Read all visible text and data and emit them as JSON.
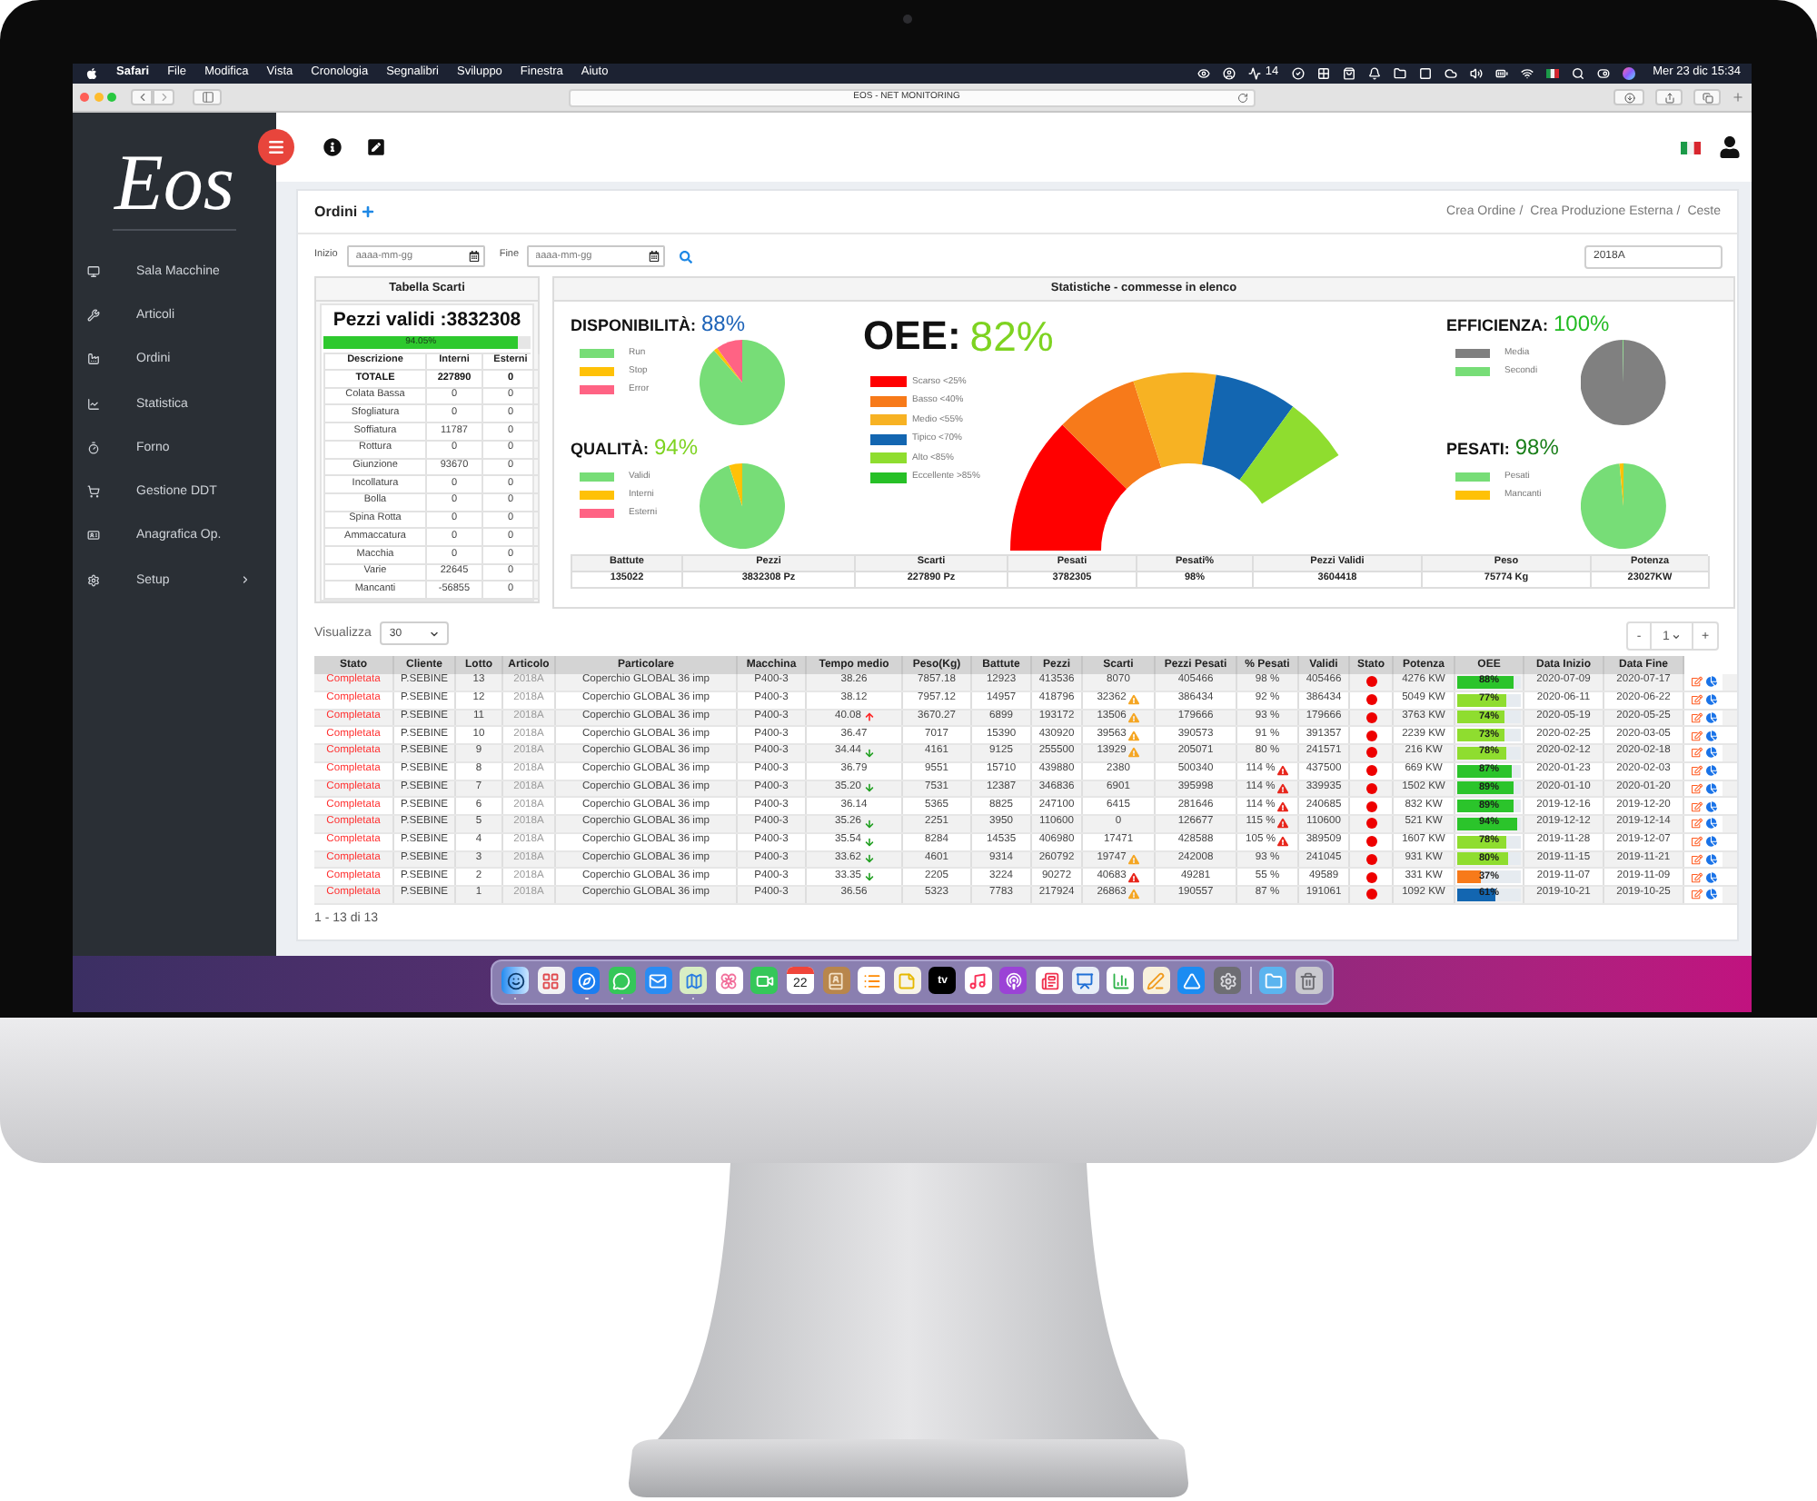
{
  "menu_bar": {
    "app": "Safari",
    "menus": [
      "File",
      "Modifica",
      "Vista",
      "Cronologia",
      "Segnalibri",
      "Sviluppo",
      "Finestra",
      "Aiuto"
    ],
    "badge": "14",
    "clock": "Mer 23 dic 15:34"
  },
  "browser": {
    "address": "EOS - NET MONITORING"
  },
  "sidebar": {
    "logo": "Eos",
    "items": [
      {
        "label": "Sala Macchine",
        "submenu": false
      },
      {
        "label": "Articoli",
        "submenu": false
      },
      {
        "label": "Ordini",
        "submenu": false
      },
      {
        "label": "Statistica",
        "submenu": false
      },
      {
        "label": "Forno",
        "submenu": false
      },
      {
        "label": "Gestione DDT",
        "submenu": false
      },
      {
        "label": "Anagrafica Op.",
        "submenu": false
      },
      {
        "label": "Setup",
        "submenu": true
      }
    ]
  },
  "page": {
    "title": "Ordini",
    "breadcrumbs": [
      {
        "label": "Crea Ordine",
        "separator": "/"
      },
      {
        "label": "Crea Produzione Esterna",
        "separator": "/"
      },
      {
        "label": "Ceste"
      }
    ]
  },
  "filters": {
    "start": {
      "label": "Inizio",
      "placeholder": "aaaa-mm-gg"
    },
    "end": {
      "label": "Fine",
      "placeholder": "aaaa-mm-gg"
    },
    "article": {
      "value": "2018A"
    }
  },
  "scrap_table": {
    "title": "Tabella Scarti",
    "valid_pieces": "Pezzi validi :3832308",
    "progress": {
      "label": "94.05%",
      "level": 0.9405
    },
    "columns": [
      "Descrizione",
      "Interni",
      "Esterni"
    ],
    "rows": [
      {
        "kind": "total",
        "cells": [
          "TOTALE",
          "227890",
          "0"
        ]
      },
      {
        "kind": "item",
        "cells": [
          "Colata Bassa",
          "0",
          "0"
        ]
      },
      {
        "kind": "item",
        "cells": [
          "Sfogliatura",
          "0",
          "0"
        ]
      },
      {
        "kind": "item",
        "cells": [
          "Soffiatura",
          "11787",
          "0"
        ]
      },
      {
        "kind": "item",
        "cells": [
          "Rottura",
          "0",
          "0"
        ]
      },
      {
        "kind": "item",
        "cells": [
          "Giunzione",
          "93670",
          "0"
        ]
      },
      {
        "kind": "item",
        "cells": [
          "Incollatura",
          "0",
          "0"
        ]
      },
      {
        "kind": "item",
        "cells": [
          "Bolla",
          "0",
          "0"
        ]
      },
      {
        "kind": "item",
        "cells": [
          "Spina Rotta",
          "0",
          "0"
        ]
      },
      {
        "kind": "item",
        "cells": [
          "Ammaccatura",
          "0",
          "0"
        ]
      },
      {
        "kind": "item",
        "cells": [
          "Macchia",
          "0",
          "0"
        ]
      },
      {
        "kind": "item",
        "cells": [
          "Varie",
          "22645",
          "0"
        ]
      },
      {
        "kind": "item",
        "cells": [
          "Mancanti",
          "-56855",
          "0"
        ]
      }
    ]
  },
  "statistics": {
    "title": "Statistiche - commesse in elenco",
    "left_kpis": [
      {
        "label": "DISPONIBILITÀ:",
        "value": "88%",
        "color": "#1d63b8",
        "legend": [
          {
            "label": "Run",
            "color": "#77dd77"
          },
          {
            "label": "Stop",
            "color": "#ffc107"
          },
          {
            "label": "Error",
            "color": "#ff6384"
          }
        ]
      },
      {
        "label": "QUALITÀ:",
        "value": "94%",
        "color": "#7ed321",
        "legend": [
          {
            "label": "Validi",
            "color": "#77dd77"
          },
          {
            "label": "Interni",
            "color": "#ffc107"
          },
          {
            "label": "Esterni",
            "color": "#ff6384"
          }
        ]
      }
    ],
    "oee": {
      "label": "OEE:",
      "value": "82%",
      "color": "#7ed321",
      "legend": [
        {
          "label": "Scarso <25%",
          "color": "#ff0000"
        },
        {
          "label": "Basso <40%",
          "color": "#f77a1a"
        },
        {
          "label": "Medio <55%",
          "color": "#f7b223"
        },
        {
          "label": "Tipico <70%",
          "color": "#1366b1"
        },
        {
          "label": "Alto <85%",
          "color": "#8fdd2f"
        },
        {
          "label": "Eccellente >85%",
          "color": "#27c027"
        }
      ]
    },
    "right_kpis": [
      {
        "label": "EFFICIENZA:",
        "value": "100%",
        "color": "#22bb22",
        "legend": [
          {
            "label": "Media",
            "color": "#808080"
          },
          {
            "label": "Secondi",
            "color": "#77dd77"
          }
        ]
      },
      {
        "label": "PESATI:",
        "value": "98%",
        "color": "#1a7f1a",
        "legend": [
          {
            "label": "Pesati",
            "color": "#77dd77"
          },
          {
            "label": "Mancanti",
            "color": "#ffc107"
          }
        ]
      }
    ],
    "summary": {
      "columns": [
        "Battute",
        "Pezzi",
        "Scarti",
        "Pesati",
        "Pesati%",
        "Pezzi Validi",
        "Peso",
        "Potenza"
      ],
      "values": [
        "135022",
        "3832308 Pz",
        "227890 Pz",
        "3782305",
        "98%",
        "3604418",
        "75774 Kg",
        "23027KW"
      ]
    }
  },
  "orders": {
    "page_size": {
      "label": "Visualizza",
      "value": "30"
    },
    "pager": {
      "previous": "-",
      "page": "1",
      "next": "+"
    },
    "columns": [
      "Stato",
      "Cliente",
      "Lotto",
      "Articolo",
      "Particolare",
      "Macchina",
      "Tempo medio",
      "Peso(Kg)",
      "Battute",
      "Pezzi",
      "Scarti",
      "Pezzi Pesati",
      "% Pesati",
      "Validi",
      "Stato",
      "Potenza",
      "OEE",
      "Data Inizio",
      "Data Fine"
    ],
    "rows": [
      {
        "status": "Completata",
        "client": "P.SEBINE",
        "lot": "13",
        "article": "2018A",
        "part": "Coperchio GLOBAL 36 imp",
        "machine": "P400-3",
        "avg_time": "38.26",
        "trend_up": false,
        "trend_down": false,
        "weight": "7857.18",
        "strokes": "12923",
        "pieces": "413536",
        "scrap": "8070",
        "scrap_warning": {
          "on": false
        },
        "weighed": "405466",
        "weighed_pct": "98 %",
        "weighed_warning": {
          "on": false
        },
        "valid": "405466",
        "color": "#ee0000",
        "power": "4276 KW",
        "oee": {
          "label": "88%",
          "level": 0.88,
          "color": "#2bc42b"
        },
        "start": "2020-07-09",
        "end": "2020-07-17"
      },
      {
        "status": "Completata",
        "client": "P.SEBINE",
        "lot": "12",
        "article": "2018A",
        "part": "Coperchio GLOBAL 36 imp",
        "machine": "P400-3",
        "avg_time": "38.12",
        "trend_up": false,
        "trend_down": false,
        "weight": "7957.12",
        "strokes": "14957",
        "pieces": "418796",
        "scrap": "32362",
        "scrap_warning": {
          "on": true,
          "color": "#f5a623"
        },
        "weighed": "386434",
        "weighed_pct": "92 %",
        "weighed_warning": {
          "on": false
        },
        "valid": "386434",
        "color": "#ee0000",
        "power": "5049 KW",
        "oee": {
          "label": "77%",
          "level": 0.77,
          "color": "#8fdd2f"
        },
        "start": "2020-06-11",
        "end": "2020-06-22"
      },
      {
        "status": "Completata",
        "client": "P.SEBINE",
        "lot": "11",
        "article": "2018A",
        "part": "Coperchio GLOBAL 36 imp",
        "machine": "P400-3",
        "avg_time": "40.08",
        "trend_up": true,
        "trend_down": false,
        "weight": "3670.27",
        "strokes": "6899",
        "pieces": "193172",
        "scrap": "13506",
        "scrap_warning": {
          "on": true,
          "color": "#f5a623"
        },
        "weighed": "179666",
        "weighed_pct": "93 %",
        "weighed_warning": {
          "on": false
        },
        "valid": "179666",
        "color": "#ee0000",
        "power": "3763 KW",
        "oee": {
          "label": "74%",
          "level": 0.74,
          "color": "#8fdd2f"
        },
        "start": "2020-05-19",
        "end": "2020-05-25"
      },
      {
        "status": "Completata",
        "client": "P.SEBINE",
        "lot": "10",
        "article": "2018A",
        "part": "Coperchio GLOBAL 36 imp",
        "machine": "P400-3",
        "avg_time": "36.47",
        "trend_up": false,
        "trend_down": false,
        "weight": "7017",
        "strokes": "15390",
        "pieces": "430920",
        "scrap": "39563",
        "scrap_warning": {
          "on": true,
          "color": "#f5a623"
        },
        "weighed": "390573",
        "weighed_pct": "91 %",
        "weighed_warning": {
          "on": false
        },
        "valid": "391357",
        "color": "#ee0000",
        "power": "2239 KW",
        "oee": {
          "label": "73%",
          "level": 0.73,
          "color": "#8fdd2f"
        },
        "start": "2020-02-25",
        "end": "2020-03-05"
      },
      {
        "status": "Completata",
        "client": "P.SEBINE",
        "lot": "9",
        "article": "2018A",
        "part": "Coperchio GLOBAL 36 imp",
        "machine": "P400-3",
        "avg_time": "34.44",
        "trend_up": false,
        "trend_down": true,
        "weight": "4161",
        "strokes": "9125",
        "pieces": "255500",
        "scrap": "13929",
        "scrap_warning": {
          "on": true,
          "color": "#f5a623"
        },
        "weighed": "205071",
        "weighed_pct": "80 %",
        "weighed_warning": {
          "on": false
        },
        "valid": "241571",
        "color": "#ee0000",
        "power": "216 KW",
        "oee": {
          "label": "78%",
          "level": 0.78,
          "color": "#8fdd2f"
        },
        "start": "2020-02-12",
        "end": "2020-02-18"
      },
      {
        "status": "Completata",
        "client": "P.SEBINE",
        "lot": "8",
        "article": "2018A",
        "part": "Coperchio GLOBAL 36 imp",
        "machine": "P400-3",
        "avg_time": "36.79",
        "trend_up": false,
        "trend_down": false,
        "weight": "9551",
        "strokes": "15710",
        "pieces": "439880",
        "scrap": "2380",
        "scrap_warning": {
          "on": false
        },
        "weighed": "500340",
        "weighed_pct": "114 %",
        "weighed_warning": {
          "on": true,
          "color": "#e8261c"
        },
        "valid": "437500",
        "color": "#ee0000",
        "power": "669 KW",
        "oee": {
          "label": "87%",
          "level": 0.87,
          "color": "#2bc42b"
        },
        "start": "2020-01-23",
        "end": "2020-02-03"
      },
      {
        "status": "Completata",
        "client": "P.SEBINE",
        "lot": "7",
        "article": "2018A",
        "part": "Coperchio GLOBAL 36 imp",
        "machine": "P400-3",
        "avg_time": "35.20",
        "trend_up": false,
        "trend_down": true,
        "weight": "7531",
        "strokes": "12387",
        "pieces": "346836",
        "scrap": "6901",
        "scrap_warning": {
          "on": false
        },
        "weighed": "395998",
        "weighed_pct": "114 %",
        "weighed_warning": {
          "on": true,
          "color": "#e8261c"
        },
        "valid": "339935",
        "color": "#ee0000",
        "power": "1502 KW",
        "oee": {
          "label": "89%",
          "level": 0.89,
          "color": "#2bc42b"
        },
        "start": "2020-01-10",
        "end": "2020-01-20"
      },
      {
        "status": "Completata",
        "client": "P.SEBINE",
        "lot": "6",
        "article": "2018A",
        "part": "Coperchio GLOBAL 36 imp",
        "machine": "P400-3",
        "avg_time": "36.14",
        "trend_up": false,
        "trend_down": false,
        "weight": "5365",
        "strokes": "8825",
        "pieces": "247100",
        "scrap": "6415",
        "scrap_warning": {
          "on": false
        },
        "weighed": "281646",
        "weighed_pct": "114 %",
        "weighed_warning": {
          "on": true,
          "color": "#e8261c"
        },
        "valid": "240685",
        "color": "#ee0000",
        "power": "832 KW",
        "oee": {
          "label": "89%",
          "level": 0.89,
          "color": "#2bc42b"
        },
        "start": "2019-12-16",
        "end": "2019-12-20"
      },
      {
        "status": "Completata",
        "client": "P.SEBINE",
        "lot": "5",
        "article": "2018A",
        "part": "Coperchio GLOBAL 36 imp",
        "machine": "P400-3",
        "avg_time": "35.26",
        "trend_up": false,
        "trend_down": true,
        "weight": "2251",
        "strokes": "3950",
        "pieces": "110600",
        "scrap": "0",
        "scrap_warning": {
          "on": false
        },
        "weighed": "126677",
        "weighed_pct": "115 %",
        "weighed_warning": {
          "on": true,
          "color": "#e8261c"
        },
        "valid": "110600",
        "color": "#ee0000",
        "power": "521 KW",
        "oee": {
          "label": "94%",
          "level": 0.94,
          "color": "#2bc42b"
        },
        "start": "2019-12-12",
        "end": "2019-12-14"
      },
      {
        "status": "Completata",
        "client": "P.SEBINE",
        "lot": "4",
        "article": "2018A",
        "part": "Coperchio GLOBAL 36 imp",
        "machine": "P400-3",
        "avg_time": "35.54",
        "trend_up": false,
        "trend_down": true,
        "weight": "8284",
        "strokes": "14535",
        "pieces": "406980",
        "scrap": "17471",
        "scrap_warning": {
          "on": false
        },
        "weighed": "428588",
        "weighed_pct": "105 %",
        "weighed_warning": {
          "on": true,
          "color": "#e8261c"
        },
        "valid": "389509",
        "color": "#ee0000",
        "power": "1607 KW",
        "oee": {
          "label": "78%",
          "level": 0.78,
          "color": "#8fdd2f"
        },
        "start": "2019-11-28",
        "end": "2019-12-07"
      },
      {
        "status": "Completata",
        "client": "P.SEBINE",
        "lot": "3",
        "article": "2018A",
        "part": "Coperchio GLOBAL 36 imp",
        "machine": "P400-3",
        "avg_time": "33.62",
        "trend_up": false,
        "trend_down": true,
        "weight": "4601",
        "strokes": "9314",
        "pieces": "260792",
        "scrap": "19747",
        "scrap_warning": {
          "on": true,
          "color": "#f5a623"
        },
        "weighed": "242008",
        "weighed_pct": "93 %",
        "weighed_warning": {
          "on": false
        },
        "valid": "241045",
        "color": "#ee0000",
        "power": "931 KW",
        "oee": {
          "label": "80%",
          "level": 0.8,
          "color": "#8fdd2f"
        },
        "start": "2019-11-15",
        "end": "2019-11-21"
      },
      {
        "status": "Completata",
        "client": "P.SEBINE",
        "lot": "2",
        "article": "2018A",
        "part": "Coperchio GLOBAL 36 imp",
        "machine": "P400-3",
        "avg_time": "33.35",
        "trend_up": false,
        "trend_down": true,
        "weight": "2205",
        "strokes": "3224",
        "pieces": "90272",
        "scrap": "40683",
        "scrap_warning": {
          "on": true,
          "color": "#e8261c"
        },
        "weighed": "49281",
        "weighed_pct": "55 %",
        "weighed_warning": {
          "on": false
        },
        "valid": "49589",
        "color": "#ee0000",
        "power": "331 KW",
        "oee": {
          "label": "37%",
          "level": 0.37,
          "color": "#f77a1a"
        },
        "start": "2019-11-07",
        "end": "2019-11-09"
      },
      {
        "status": "Completata",
        "client": "P.SEBINE",
        "lot": "1",
        "article": "2018A",
        "part": "Coperchio GLOBAL 36 imp",
        "machine": "P400-3",
        "avg_time": "36.56",
        "trend_up": false,
        "trend_down": false,
        "weight": "5323",
        "strokes": "7783",
        "pieces": "217924",
        "scrap": "26863",
        "scrap_warning": {
          "on": true,
          "color": "#f5a623"
        },
        "weighed": "190557",
        "weighed_pct": "87 %",
        "weighed_warning": {
          "on": false
        },
        "valid": "191061",
        "color": "#ee0000",
        "power": "1092 KW",
        "oee": {
          "label": "61%",
          "level": 0.61,
          "color": "#1366b1"
        },
        "start": "2019-10-21",
        "end": "2019-10-25"
      }
    ],
    "footer": "1 - 13 di 13"
  },
  "dock": {
    "calendar_day": "22",
    "tv_label": "tv"
  }
}
